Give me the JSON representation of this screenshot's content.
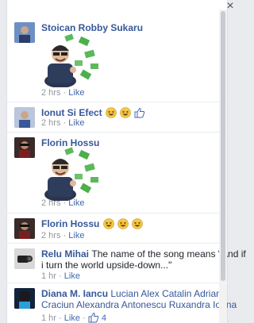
{
  "close_icon": "×",
  "comments": [
    {
      "name": "Stoican Robby Sukaru",
      "time": "2 hrs",
      "like": "Like",
      "sticker": "money-guy-sticker"
    },
    {
      "name": "Ionut Si Efect",
      "time": "2 hrs",
      "like": "Like",
      "emojis": [
        "laughing-emoji",
        "laughing-emoji",
        "thumbs-up-emoji"
      ]
    },
    {
      "name": "Florin Hossu",
      "time": "2 hrs",
      "like": "Like",
      "sticker": "money-guy-sticker"
    },
    {
      "name": "Florin Hossu",
      "time": "2 hrs",
      "like": "Like",
      "emojis": [
        "laughing-emoji",
        "laughing-emoji",
        "laughing-emoji"
      ]
    },
    {
      "name": "Relu Mihai",
      "text_line1": "The name of the song means \"And if",
      "text_line2": "i turn the world upside-down...\"",
      "time": "1 hr",
      "like": "Like"
    },
    {
      "name": "Diana M. Iancu",
      "tags_line1": "Lucian Alex Catalin Adrian",
      "tags_line2": "Craciun Alexandra Antonescu Ruxandra Ioana",
      "time": "1 hr",
      "like": "Like",
      "like_count": "4"
    }
  ],
  "separator": "·",
  "colors": {
    "name": "#365899",
    "link": "#4267b2",
    "meta": "#90949c",
    "emoji": "#f7c844"
  }
}
